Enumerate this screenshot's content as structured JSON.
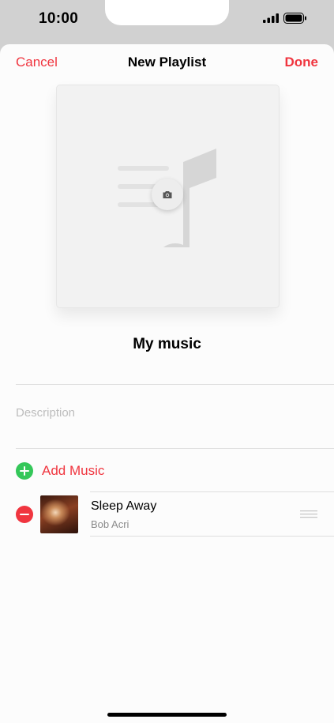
{
  "status_bar": {
    "time": "10:00"
  },
  "nav": {
    "cancel_label": "Cancel",
    "title": "New Playlist",
    "done_label": "Done"
  },
  "artwork": {
    "icon": "music-note-icon",
    "edit_icon": "camera-icon"
  },
  "playlist": {
    "name": "My music",
    "description_placeholder": "Description"
  },
  "add_music": {
    "label": "Add Music",
    "icon": "plus-circle-icon"
  },
  "tracks": [
    {
      "title": "Sleep Away",
      "artist": "Bob Acri",
      "remove_icon": "minus-circle-icon",
      "reorder_icon": "drag-handle-icon"
    }
  ],
  "colors": {
    "accent": "#f0353f",
    "add_green": "#34c759",
    "remove_red": "#f0353f"
  }
}
